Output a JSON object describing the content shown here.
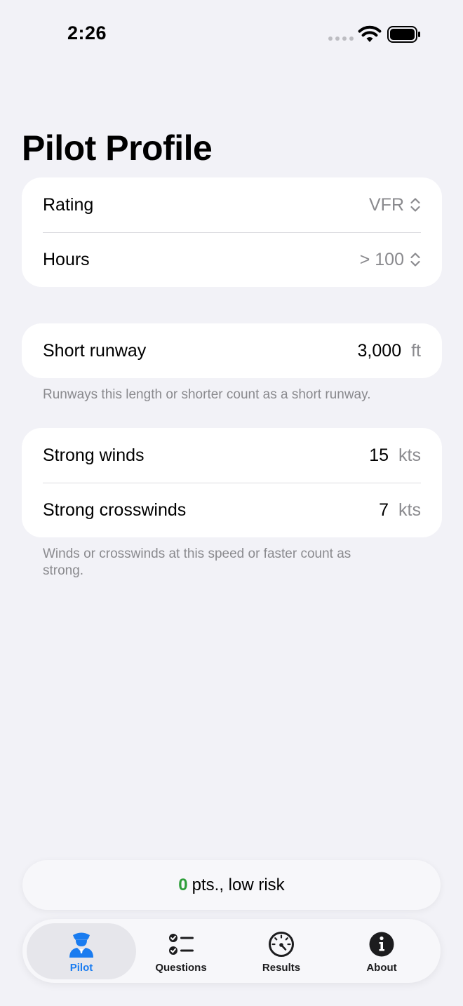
{
  "status_bar": {
    "time": "2:26"
  },
  "page_title": "Pilot Profile",
  "profile_card": {
    "rating": {
      "label": "Rating",
      "value": "VFR"
    },
    "hours": {
      "label": "Hours",
      "value": "> 100"
    }
  },
  "runway_card": {
    "short_runway": {
      "label": "Short runway",
      "value": "3,000",
      "unit": "ft"
    },
    "footnote": "Runways this length or shorter count as a short runway."
  },
  "wind_card": {
    "strong_winds": {
      "label": "Strong winds",
      "value": "15",
      "unit": "kts"
    },
    "strong_crosswinds": {
      "label": "Strong crosswinds",
      "value": "7",
      "unit": "kts"
    },
    "footnote": "Winds or crosswinds at this speed or faster count as strong."
  },
  "risk_summary": {
    "points": "0",
    "text": "pts., low risk"
  },
  "tabs": [
    {
      "label": "Pilot",
      "icon": "pilot-icon",
      "active": true
    },
    {
      "label": "Questions",
      "icon": "checklist-icon",
      "active": false
    },
    {
      "label": "Results",
      "icon": "gauge-icon",
      "active": false
    },
    {
      "label": "About",
      "icon": "info-icon",
      "active": false
    }
  ],
  "colors": {
    "background": "#F2F2F7",
    "card": "#FFFFFF",
    "accent_blue": "#1A7CF0",
    "risk_green": "#2E9E3A",
    "secondary_text": "#8A8A8E"
  }
}
